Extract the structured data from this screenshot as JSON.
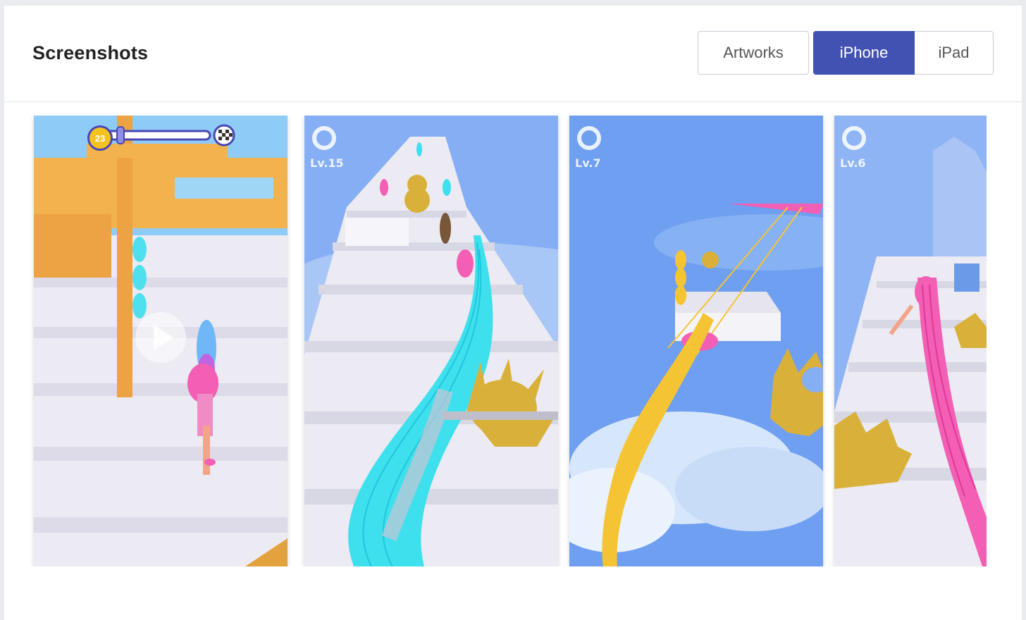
{
  "section": {
    "title": "Screenshots"
  },
  "tabs": {
    "artworks": "Artworks",
    "iphone": "iPhone",
    "ipad": "iPad",
    "active": "iPhone"
  },
  "screenshots": [
    {
      "hud": "",
      "level_badge": "23"
    },
    {
      "hud": "Lv.15"
    },
    {
      "hud": "Lv.7"
    },
    {
      "hud": "Lv.6"
    }
  ],
  "colors": {
    "accent": "#4252b3",
    "sky": "#8cb4f5",
    "hair_cyan": "#3fe0ee",
    "hair_pink": "#f25fb4",
    "hair_gold": "#f5c435",
    "saw_gold": "#d9b13a"
  }
}
